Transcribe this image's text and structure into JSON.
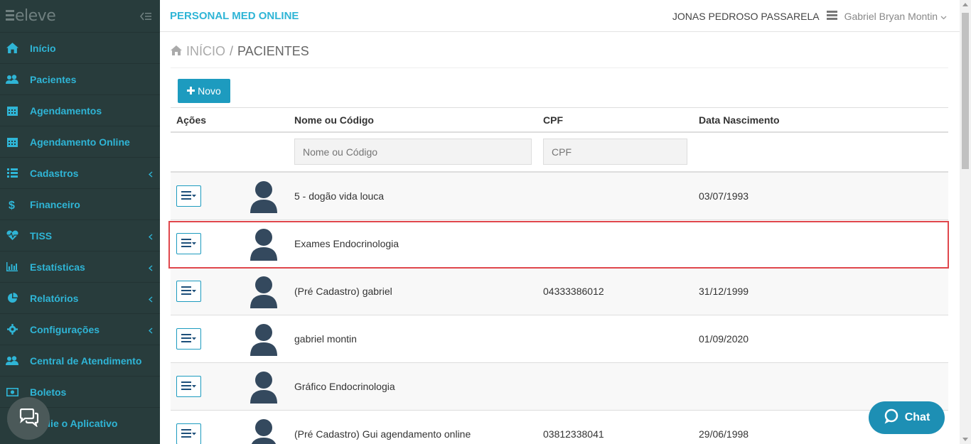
{
  "app": {
    "brand": "PERSONAL MED ONLINE",
    "logo_text": "eleve",
    "clinic_name": "JONAS PEDROSO PASSARELA",
    "user_name": "Gabriel Bryan Montin"
  },
  "sidebar": {
    "items": [
      {
        "label": "Início",
        "icon": "home-icon"
      },
      {
        "label": "Pacientes",
        "icon": "users-icon"
      },
      {
        "label": "Agendamentos",
        "icon": "calendar-icon"
      },
      {
        "label": "Agendamento Online",
        "icon": "calendar-icon"
      },
      {
        "label": "Cadastros",
        "icon": "list-icon"
      },
      {
        "label": "Financeiro",
        "icon": "dollar-icon"
      },
      {
        "label": "TISS",
        "icon": "heartbeat-icon"
      },
      {
        "label": "Estatísticas",
        "icon": "bar-chart-icon"
      },
      {
        "label": "Relatórios",
        "icon": "pie-chart-icon"
      },
      {
        "label": "Configurações",
        "icon": "gear-icon"
      },
      {
        "label": "Central de Atendimento",
        "icon": "users-icon"
      },
      {
        "label": "Boletos",
        "icon": "money-icon"
      },
      {
        "label": "Avalie o Aplicativo",
        "icon": "star-icon"
      }
    ]
  },
  "breadcrumb": {
    "home": "INÍCIO",
    "separator": "/",
    "current": "PACIENTES"
  },
  "toolbar": {
    "new_label": "Novo"
  },
  "table": {
    "headers": {
      "actions": "Ações",
      "name": "Nome ou Código",
      "cpf": "CPF",
      "birth": "Data Nascimento"
    },
    "filters": {
      "name_placeholder": "Nome ou Código",
      "cpf_placeholder": "CPF"
    },
    "rows": [
      {
        "name": "5 - dogão vida louca",
        "cpf": "",
        "birth": "03/07/1993"
      },
      {
        "name": "Exames Endocrinologia",
        "cpf": "",
        "birth": ""
      },
      {
        "name": "(Pré Cadastro) gabriel",
        "cpf": "04333386012",
        "birth": "31/12/1999"
      },
      {
        "name": "gabriel montin",
        "cpf": "",
        "birth": "01/09/2020"
      },
      {
        "name": "Gráfico Endocrinologia",
        "cpf": "",
        "birth": ""
      },
      {
        "name": "(Pré Cadastro) Gui agendamento online",
        "cpf": "03812338041",
        "birth": "29/06/1998"
      }
    ]
  },
  "widgets": {
    "chat_label": "Chat"
  },
  "colors": {
    "accent": "#2fb5d6",
    "button": "#1d9bbf",
    "sidebar_bg": "#283c3c",
    "highlight": "#e0474c"
  }
}
